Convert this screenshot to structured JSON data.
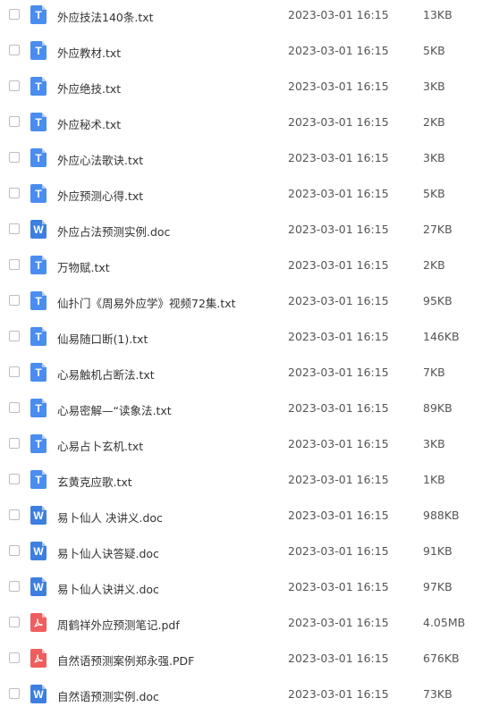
{
  "files": [
    {
      "name": "外应技法140条.txt",
      "type": "txt",
      "date": "2023-03-01 16:15",
      "size": "13KB"
    },
    {
      "name": "外应教材.txt",
      "type": "txt",
      "date": "2023-03-01 16:15",
      "size": "5KB"
    },
    {
      "name": "外应绝技.txt",
      "type": "txt",
      "date": "2023-03-01 16:15",
      "size": "3KB"
    },
    {
      "name": "外应秘术.txt",
      "type": "txt",
      "date": "2023-03-01 16:15",
      "size": "2KB"
    },
    {
      "name": "外应心法歌诀.txt",
      "type": "txt",
      "date": "2023-03-01 16:15",
      "size": "3KB"
    },
    {
      "name": "外应预测心得.txt",
      "type": "txt",
      "date": "2023-03-01 16:15",
      "size": "5KB"
    },
    {
      "name": "外应占法预测实例.doc",
      "type": "doc",
      "date": "2023-03-01 16:15",
      "size": "27KB"
    },
    {
      "name": "万物赋.txt",
      "type": "txt",
      "date": "2023-03-01 16:15",
      "size": "2KB"
    },
    {
      "name": "仙扑门《周易外应学》视频72集.txt",
      "type": "txt",
      "date": "2023-03-01 16:15",
      "size": "95KB"
    },
    {
      "name": "仙易随口断(1).txt",
      "type": "txt",
      "date": "2023-03-01 16:15",
      "size": "146KB"
    },
    {
      "name": "心易触机占断法.txt",
      "type": "txt",
      "date": "2023-03-01 16:15",
      "size": "7KB"
    },
    {
      "name": "心易密解—“读象法.txt",
      "type": "txt",
      "date": "2023-03-01 16:15",
      "size": "89KB"
    },
    {
      "name": "心易占卜玄机.txt",
      "type": "txt",
      "date": "2023-03-01 16:15",
      "size": "3KB"
    },
    {
      "name": "玄黄克应歌.txt",
      "type": "txt",
      "date": "2023-03-01 16:15",
      "size": "1KB"
    },
    {
      "name": "易卜仙人 决讲义.doc",
      "type": "doc",
      "date": "2023-03-01 16:15",
      "size": "988KB"
    },
    {
      "name": "易卜仙人诀答疑.doc",
      "type": "doc",
      "date": "2023-03-01 16:15",
      "size": "91KB"
    },
    {
      "name": "易卜仙人诀讲义.doc",
      "type": "doc",
      "date": "2023-03-01 16:15",
      "size": "97KB"
    },
    {
      "name": "周鹤祥外应预测笔记.pdf",
      "type": "pdf",
      "date": "2023-03-01 16:15",
      "size": "4.05MB"
    },
    {
      "name": "自然语预测案例郑永强.PDF",
      "type": "pdf",
      "date": "2023-03-01 16:15",
      "size": "676KB"
    },
    {
      "name": "自然语预测实例.doc",
      "type": "doc",
      "date": "2023-03-01 16:15",
      "size": "73KB"
    }
  ],
  "icons": {
    "txt": {
      "glyph": "T",
      "icon_name": "txt-file-icon",
      "color": "#4a8df0"
    },
    "doc": {
      "glyph": "W",
      "icon_name": "word-file-icon",
      "color": "#3d7fe0"
    },
    "pdf": {
      "glyph": "",
      "icon_name": "pdf-file-icon",
      "color": "#f05d5e"
    }
  }
}
